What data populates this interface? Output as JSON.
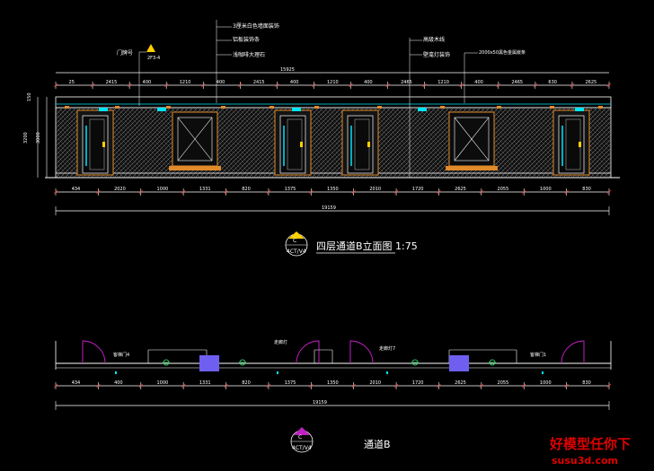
{
  "elevation": {
    "ceiling_notes": [
      "门牌号",
      "2F3-4"
    ],
    "annotations_top": [
      "3厘米白色墙面装饰",
      "铝板装饰条",
      "浅咖啡大理石",
      "高级木线",
      "壁龛灯装饰",
      "2000x50黑色金属嵌条"
    ],
    "overall_width_top": "15925",
    "top_dims": [
      "25",
      "2415",
      "400",
      "1210",
      "400",
      "2415",
      "400",
      "1210",
      "400",
      "2465",
      "1210",
      "400",
      "2465",
      "630",
      "2625"
    ],
    "heights": [
      "150",
      "3200",
      "3000"
    ],
    "bottom_dims": [
      "434",
      "2020",
      "1000",
      "1331",
      "820",
      "1375",
      "1350",
      "2010",
      "1720",
      "2625",
      "2055",
      "1000",
      "830"
    ],
    "overall_width_bottom": "19159",
    "title_code_top": "C",
    "title_code_bottom": "4CT/V4",
    "title": "四层通道B立面图 1:75"
  },
  "plan": {
    "labels": [
      "客梯门4",
      "走廊灯",
      "走廊灯7",
      "客梯门1"
    ],
    "bottom_dims": [
      "434",
      "400",
      "1000",
      "1331",
      "820",
      "1375",
      "1350",
      "2010",
      "1720",
      "2625",
      "2055",
      "1000",
      "830"
    ],
    "overall_width": "19159",
    "title_code_top": "C",
    "title_code_bottom": "4CT/V4",
    "title": "通道B"
  },
  "watermark": {
    "line1": "好模型任你下",
    "line2": "susu3d.com"
  },
  "colors": {
    "line": "#ffffff",
    "yellow": "#ffd000",
    "cyan": "#00e5ff",
    "magenta": "#c020c0",
    "orange": "#e08a2a",
    "blue": "#6f5ff0",
    "green": "#2fc060",
    "watermark": "#e00000"
  }
}
